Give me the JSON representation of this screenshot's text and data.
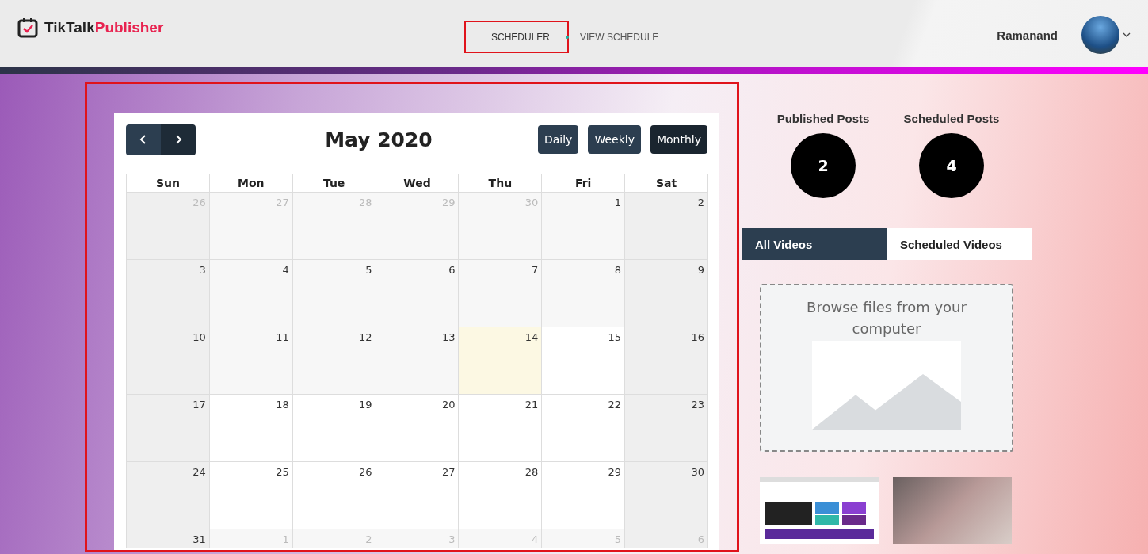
{
  "header": {
    "logo_text": "TikTalk",
    "logo_accent": "Publisher",
    "nav": [
      {
        "label": "SCHEDULER",
        "selected": true,
        "highlighted": true
      },
      {
        "label": "VIEW SCHEDULE",
        "selected": false,
        "highlighted": false
      }
    ],
    "user_name": "Ramanand"
  },
  "calendar": {
    "highlighted": true,
    "title": "May 2020",
    "views": [
      {
        "label": "Daily",
        "selected": false
      },
      {
        "label": "Weekly",
        "selected": false
      },
      {
        "label": "Monthly",
        "selected": true
      }
    ],
    "weekdays": [
      "Sun",
      "Mon",
      "Tue",
      "Wed",
      "Thu",
      "Fri",
      "Sat"
    ],
    "weeks": [
      [
        {
          "day": "26",
          "kind": "other"
        },
        {
          "day": "27",
          "kind": "other"
        },
        {
          "day": "28",
          "kind": "other"
        },
        {
          "day": "29",
          "kind": "other"
        },
        {
          "day": "30",
          "kind": "other"
        },
        {
          "day": "1",
          "kind": "past"
        },
        {
          "day": "2",
          "kind": "past"
        }
      ],
      [
        {
          "day": "3",
          "kind": "past"
        },
        {
          "day": "4",
          "kind": "past"
        },
        {
          "day": "5",
          "kind": "past"
        },
        {
          "day": "6",
          "kind": "past"
        },
        {
          "day": "7",
          "kind": "past"
        },
        {
          "day": "8",
          "kind": "past"
        },
        {
          "day": "9",
          "kind": "past"
        }
      ],
      [
        {
          "day": "10",
          "kind": "past"
        },
        {
          "day": "11",
          "kind": "past"
        },
        {
          "day": "12",
          "kind": "past"
        },
        {
          "day": "13",
          "kind": "past"
        },
        {
          "day": "14",
          "kind": "today"
        },
        {
          "day": "15",
          "kind": "future"
        },
        {
          "day": "16",
          "kind": "future"
        }
      ],
      [
        {
          "day": "17",
          "kind": "future"
        },
        {
          "day": "18",
          "kind": "future"
        },
        {
          "day": "19",
          "kind": "future"
        },
        {
          "day": "20",
          "kind": "future"
        },
        {
          "day": "21",
          "kind": "future"
        },
        {
          "day": "22",
          "kind": "future"
        },
        {
          "day": "23",
          "kind": "future"
        }
      ],
      [
        {
          "day": "24",
          "kind": "future"
        },
        {
          "day": "25",
          "kind": "future"
        },
        {
          "day": "26",
          "kind": "future"
        },
        {
          "day": "27",
          "kind": "future"
        },
        {
          "day": "28",
          "kind": "future"
        },
        {
          "day": "29",
          "kind": "future"
        },
        {
          "day": "30",
          "kind": "future"
        }
      ],
      [
        {
          "day": "31",
          "kind": "future"
        },
        {
          "day": "1",
          "kind": "other"
        },
        {
          "day": "2",
          "kind": "other"
        },
        {
          "day": "3",
          "kind": "other"
        },
        {
          "day": "4",
          "kind": "other"
        },
        {
          "day": "5",
          "kind": "other"
        },
        {
          "day": "6",
          "kind": "other"
        }
      ]
    ]
  },
  "stats": [
    {
      "label": "Published Posts",
      "count": "2"
    },
    {
      "label": "Scheduled Posts",
      "count": "4"
    }
  ],
  "video_tabs": [
    {
      "label": "All Videos",
      "selected": true
    },
    {
      "label": "Scheduled Videos",
      "selected": false
    }
  ],
  "upload": {
    "text": "Browse files from your computer"
  },
  "thumbnails": [
    {
      "kind": "screenshot"
    },
    {
      "kind": "photo"
    }
  ]
}
